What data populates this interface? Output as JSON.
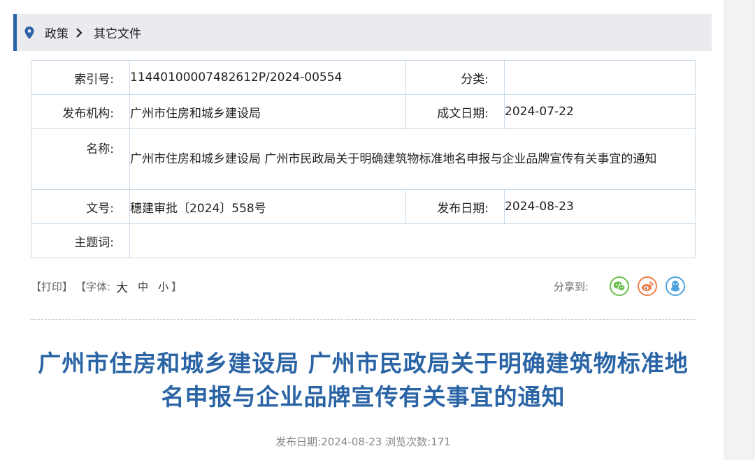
{
  "breadcrumb": {
    "items": [
      "政策",
      "其它文件"
    ]
  },
  "info": {
    "index_label": "索引号:",
    "index_value": "11440100007482612P/2024-00554",
    "category_label": "分类:",
    "category_value": "",
    "org_label": "发布机构:",
    "org_value": "广州市住房和城乡建设局",
    "created_label": "成文日期:",
    "created_value": "2024-07-22",
    "name_label": "名称:",
    "name_value": "广州市住房和城乡建设局 广州市民政局关于明确建筑物标准地名申报与企业品牌宣传有关事宜的通知",
    "doc_label": "文号:",
    "doc_value": "穗建审批〔2024〕558号",
    "published_label": "发布日期:",
    "published_value": "2024-08-23",
    "keywords_label": "主题词:",
    "keywords_value": ""
  },
  "tools": {
    "print": "【打印】",
    "font_open": "【字体:",
    "font_big": "大",
    "font_mid": "中",
    "font_small": "小",
    "font_close": "】",
    "share_label": "分享到:"
  },
  "article": {
    "title": "广州市住房和城乡建设局 广州市民政局关于明确建筑物标准地名申报与企业品牌宣传有关事宜的通知",
    "meta": "发布日期:2024-08-23  浏览次数:171"
  },
  "colors": {
    "accent": "#2c63a6",
    "title": "#2a64a5",
    "wechat": "#6bbf4e",
    "weibo": "#ef7d46",
    "qq": "#4fa3dc"
  }
}
